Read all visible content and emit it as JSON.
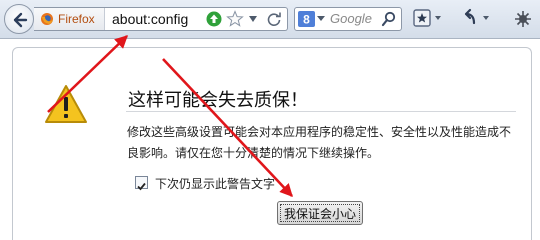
{
  "toolbar": {
    "browser_label": "Firefox",
    "url": "about:config",
    "search_placeholder": "Google",
    "icons": [
      "back-arrow-icon",
      "firefox-icon",
      "go-arrow-icon",
      "bookmark-star-icon",
      "dropdown-arrow-icon",
      "reload-icon",
      "google-search-engine-icon",
      "search-icon",
      "bookmarks-icon",
      "history-back-icon",
      "extension-icon"
    ]
  },
  "warning": {
    "title": "这样可能会失去质保！",
    "message": "修改这些高级设置可能会对本应用程序的稳定性、安全性以及性能造成不良影响。请仅在您十分清楚的情况下继续操作。",
    "checkbox_label": "下次仍显示此警告文字",
    "checkbox_checked": true,
    "button_label": "我保证会小心"
  },
  "colors": {
    "annotation_arrow": "#e0161b",
    "warning_icon": "#f4c31f",
    "go_button": "#2fa13a"
  }
}
